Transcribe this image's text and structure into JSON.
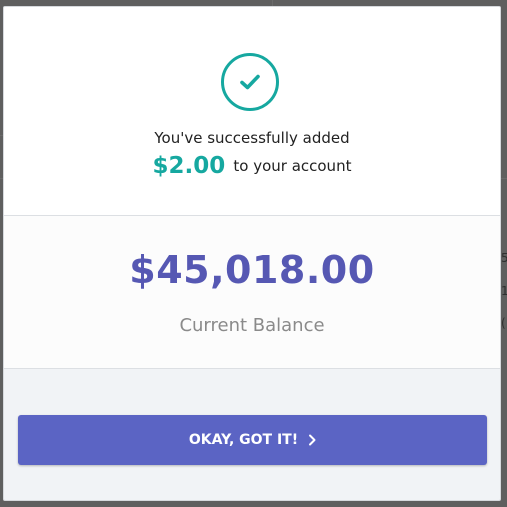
{
  "dialog": {
    "success_message": "You've successfully added",
    "added_amount": "$2.00",
    "amount_suffix": "to your account",
    "balance": "$45,018.00",
    "balance_label": "Current Balance",
    "button_label": "OKAY, GOT IT!"
  },
  "background": {
    "edge_glyphs": [
      "5",
      "1",
      "("
    ]
  },
  "colors": {
    "accent_teal": "#16a8a0",
    "balance_purple": "#5658b3",
    "button_purple": "#5b64c4",
    "overlay": "#5f5f5f"
  },
  "icons": {
    "success": "check-circle-icon",
    "button": "chevron-right-icon"
  }
}
